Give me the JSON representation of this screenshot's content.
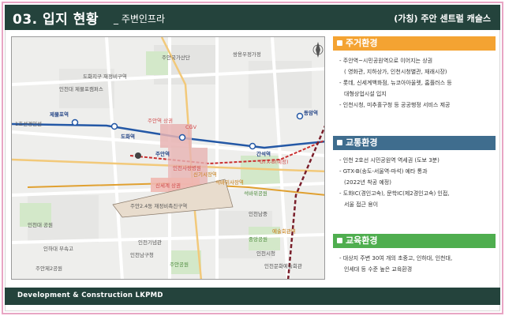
{
  "header": {
    "title": "03. 입지 현황",
    "subtitle": "_ 주변인프라",
    "project": "(가칭) 주안 센트럴 캐슬스"
  },
  "footer": {
    "text": "Development & Construction LKPMD"
  },
  "colors": {
    "header_bg": "#24433c",
    "border_pink": "#e8a6c4",
    "residential": "#f4a332",
    "transport": "#3f6d8e",
    "education": "#4fae4f"
  },
  "map": {
    "labels": {
      "ssanglyong": "쌍용우정가정",
      "juan_industrial": "주안국가산단",
      "dohwa_district": "도화지구\n재정비구역",
      "incheon_park": "인천대\n제물포캠퍼스",
      "jemulpo": "제물포역",
      "seoul_line": "1호선경인선",
      "dohwa": "도화역",
      "juan": "주안역",
      "ganseok": "간석역",
      "dongam": "동암역",
      "cgv": "CGV",
      "juan_school": "주안역 상권",
      "hospital": "인천사랑병원",
      "gtx": "GTX-B(예정)",
      "site": "주안2.4동 재정비촉진구역",
      "juan_dept": "신세계 상권",
      "sinki": "신기시장역",
      "sinki2": "석바위사장역",
      "seokbawi": "석바위공원",
      "incheon_jeon": "인천남중",
      "incheon_univ": "인천대 공원",
      "incheon_hs": "인하대 부속고",
      "juan_park": "주안공원",
      "cheongwon": "중앙공원",
      "art_center": "예술회관역",
      "incheon_city": "인천시청",
      "nam_station": "인천기념관",
      "incheon_office": "인천남구청",
      "incheon_mun": "인천문화예술회관",
      "jemulpo_park": "주안제2공원"
    }
  },
  "sections": [
    {
      "title": "주거환경",
      "lines": [
        "- 주안역~시민공원역으로 이어지는 상권",
        "( 영화관, 지하상가, 인천시청별관, 재래시장)",
        "- 롯데, 신세계백화점, 뉴코아아울렛, 홈플러스 등",
        "대형상업시설 입지",
        "- 인천시청, 미추홀구청 등 공공행정 서비스 제공"
      ]
    },
    {
      "title": "교통환경",
      "lines": [
        "- 인천 2호선 시민공원역 역세권 (도보 3분)",
        "- GTX-B(송도-서울역-마석) 예타 통과",
        "(2022년 착공 예정)",
        "- 도화IC(경인고속), 문학IC(제2경인고속) 인접,",
        "서울 접근 용이"
      ]
    },
    {
      "title": "교육환경",
      "lines": [
        "- 대상지 주변 30여 개의 초중고, 인하대, 인천대,",
        "인세대 등 수준 높은 교육환경"
      ]
    }
  ]
}
